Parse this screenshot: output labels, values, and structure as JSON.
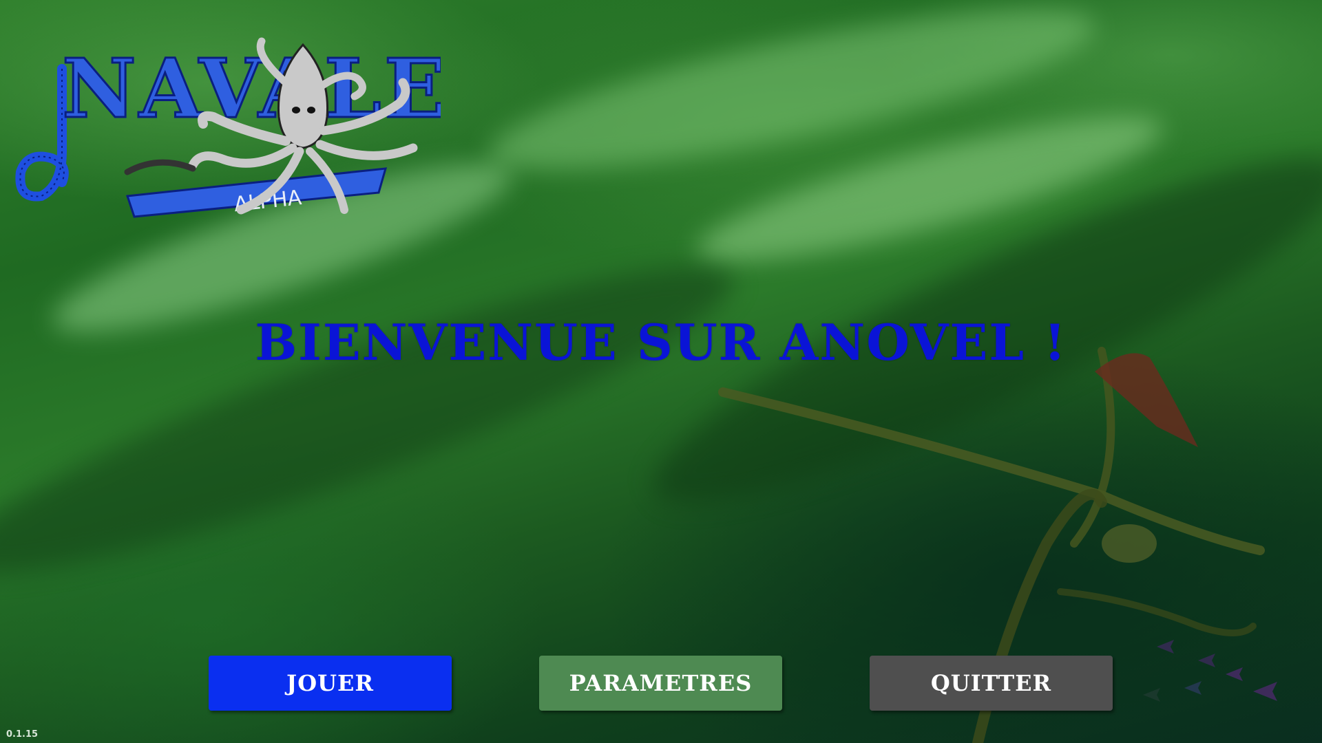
{
  "logo": {
    "title": "NAVALE",
    "badge": "ALPHA"
  },
  "welcome": {
    "title": "Bienvenue sur Anovel !"
  },
  "menu": {
    "play_label": "Jouer",
    "settings_label": "Parametres",
    "quit_label": "Quitter"
  },
  "version": "0.1.15",
  "colors": {
    "title": "#0a14d6",
    "play_button": "#0a2ff0",
    "settings_button": "#4e8a52",
    "quit_button": "#4f4f4f",
    "logo_blue": "#2f5fe0"
  }
}
